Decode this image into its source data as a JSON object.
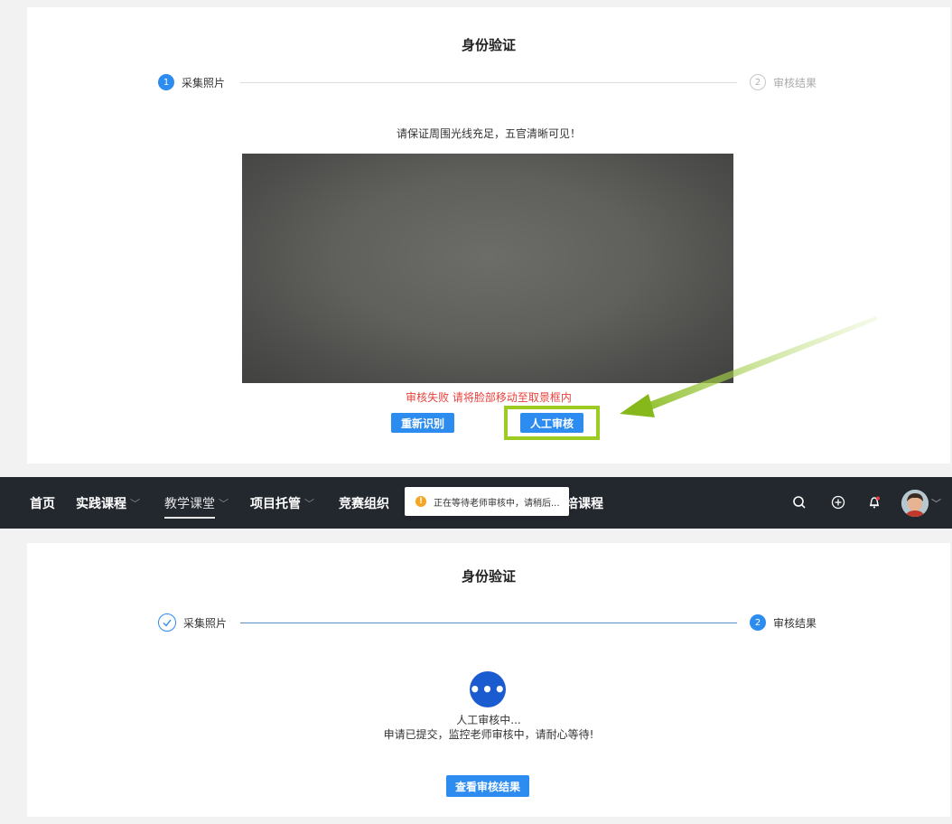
{
  "panel1": {
    "title": "身份验证",
    "step1": {
      "number": "1",
      "label": "采集照片"
    },
    "step2": {
      "number": "2",
      "label": "审核结果"
    },
    "hint": "请保证周围光线充足，五官清晰可见！",
    "error": "审核失败 请将脸部移动至取景框内",
    "retry_button": "重新识别",
    "manual_button": "人工审核"
  },
  "navbar": {
    "items": [
      {
        "label": "首页"
      },
      {
        "label": "实践课程"
      },
      {
        "label": "教学课堂"
      },
      {
        "label": "项目托管"
      },
      {
        "label": "竞赛组织"
      },
      {
        "label": "培课程"
      }
    ],
    "toast": "正在等待老师审核中，请稍后...",
    "icons": [
      "search-icon",
      "add-circle-icon",
      "bell-icon",
      "avatar"
    ]
  },
  "panel2": {
    "title": "身份验证",
    "step1": {
      "label": "采集照片"
    },
    "step2": {
      "number": "2",
      "label": "审核结果"
    },
    "status_title": "人工审核中...",
    "status_desc": "申请已提交，监控老师审核中，请耐心等待!",
    "result_button": "查看审核结果"
  },
  "colors": {
    "primary": "#2d8cf0",
    "error": "#e8413c",
    "highlight": "#9ccc22",
    "navbar": "#23272e",
    "status_icon": "#1a5ccf"
  }
}
